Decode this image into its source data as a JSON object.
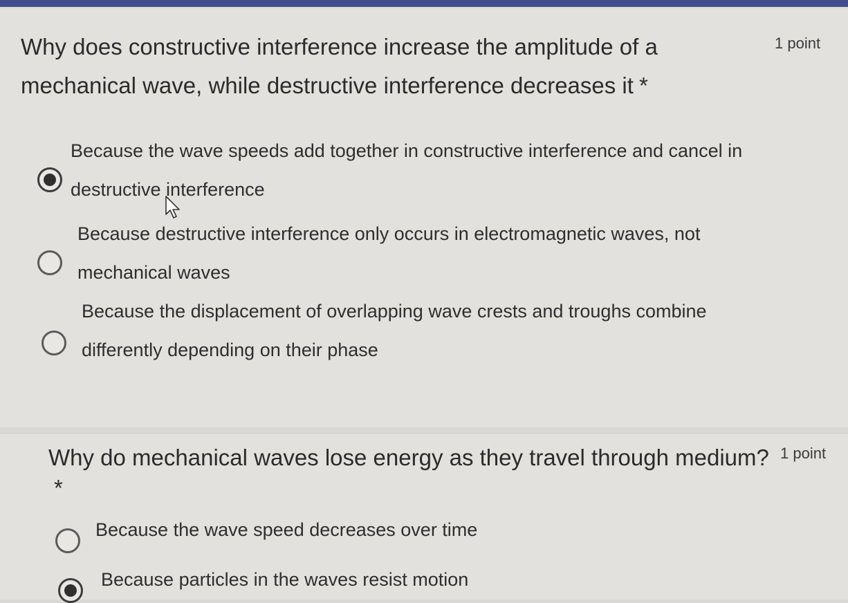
{
  "question1": {
    "title": "Why does constructive interference increase the amplitude of a mechanical wave, while destructive interference decreases it",
    "required_mark": "*",
    "points": "1 point",
    "options": [
      {
        "label": "Because the wave speeds add together in constructive interference and cancel in destructive interference",
        "selected": true
      },
      {
        "label": "Because destructive interference only occurs in electromagnetic waves, not mechanical waves",
        "selected": false
      },
      {
        "label": "Because the displacement of overlapping wave crests and troughs combine differently depending on their phase",
        "selected": false
      }
    ]
  },
  "question2": {
    "title": "Why do mechanical waves lose energy as they travel through medium?",
    "required_mark": "*",
    "points": "1 point",
    "options": [
      {
        "label": "Because the wave speed decreases over time",
        "selected": false
      },
      {
        "label": "Because particles in the waves resist motion",
        "selected": true
      }
    ]
  },
  "colors": {
    "header_accent": "#3f4d8c",
    "radio_selected": "#2f2f2f",
    "radio_border": "#5a5a5a"
  },
  "icons": {
    "cursor": "mouse-pointer-icon"
  }
}
